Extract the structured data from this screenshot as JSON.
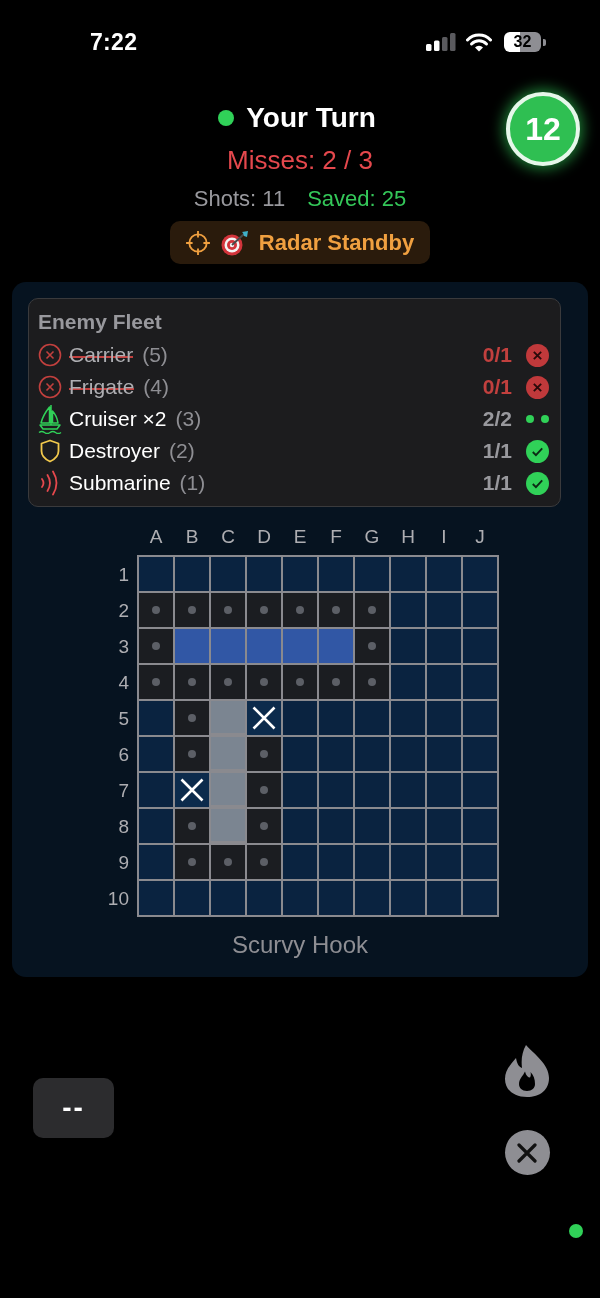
{
  "status_bar": {
    "time": "7:22",
    "battery": "32"
  },
  "turn": {
    "label": "Your Turn",
    "active": true,
    "timer": "12"
  },
  "misses": "Misses: 2 / 3",
  "stats": {
    "shots": "Shots: 11",
    "saved": "Saved: 25"
  },
  "radar": {
    "label": "Radar Standby"
  },
  "fleet": {
    "title": "Enemy Fleet",
    "ships": [
      {
        "kind": "sunk",
        "name": "Carrier",
        "size": "(5)",
        "count": "0/1"
      },
      {
        "kind": "sunk",
        "name": "Frigate",
        "size": "(4)",
        "count": "0/1"
      },
      {
        "kind": "cruiser",
        "name": "Cruiser ×2",
        "size": "(3)",
        "count": "2/2"
      },
      {
        "kind": "destroyer",
        "name": "Destroyer",
        "size": "(2)",
        "count": "1/1"
      },
      {
        "kind": "submarine",
        "name": "Submarine",
        "size": "(1)",
        "count": "1/1"
      }
    ]
  },
  "board": {
    "columns": [
      "A",
      "B",
      "C",
      "D",
      "E",
      "F",
      "G",
      "H",
      "I",
      "J"
    ],
    "rows": [
      {
        "label": "1",
        "cells": [
          {
            "kind": "fog"
          },
          {
            "kind": "fog"
          },
          {
            "kind": "fog"
          },
          {
            "kind": "fog"
          },
          {
            "kind": "fog"
          },
          {
            "kind": "fog"
          },
          {
            "kind": "fog"
          },
          {
            "kind": "fog"
          },
          {
            "kind": "fog"
          },
          {
            "kind": "fog"
          }
        ]
      },
      {
        "label": "2",
        "cells": [
          {
            "kind": "miss"
          },
          {
            "kind": "miss"
          },
          {
            "kind": "miss"
          },
          {
            "kind": "miss"
          },
          {
            "kind": "miss"
          },
          {
            "kind": "miss"
          },
          {
            "kind": "miss"
          },
          {
            "kind": "fog"
          },
          {
            "kind": "fog"
          },
          {
            "kind": "fog"
          }
        ]
      },
      {
        "label": "3",
        "cells": [
          {
            "kind": "miss"
          },
          {
            "kind": "sunk"
          },
          {
            "kind": "sunk"
          },
          {
            "kind": "sunk"
          },
          {
            "kind": "sunk"
          },
          {
            "kind": "sunk"
          },
          {
            "kind": "miss"
          },
          {
            "kind": "fog"
          },
          {
            "kind": "fog"
          },
          {
            "kind": "fog"
          }
        ]
      },
      {
        "label": "4",
        "cells": [
          {
            "kind": "miss"
          },
          {
            "kind": "miss"
          },
          {
            "kind": "miss"
          },
          {
            "kind": "miss"
          },
          {
            "kind": "miss"
          },
          {
            "kind": "miss"
          },
          {
            "kind": "miss"
          },
          {
            "kind": "fog"
          },
          {
            "kind": "fog"
          },
          {
            "kind": "fog"
          }
        ]
      },
      {
        "label": "5",
        "cells": [
          {
            "kind": "fog"
          },
          {
            "kind": "miss"
          },
          {
            "kind": "ship"
          },
          {
            "kind": "hit"
          },
          {
            "kind": "fog"
          },
          {
            "kind": "fog"
          },
          {
            "kind": "fog"
          },
          {
            "kind": "fog"
          },
          {
            "kind": "fog"
          },
          {
            "kind": "fog"
          }
        ]
      },
      {
        "label": "6",
        "cells": [
          {
            "kind": "fog"
          },
          {
            "kind": "miss"
          },
          {
            "kind": "ship"
          },
          {
            "kind": "miss"
          },
          {
            "kind": "fog"
          },
          {
            "kind": "fog"
          },
          {
            "kind": "fog"
          },
          {
            "kind": "fog"
          },
          {
            "kind": "fog"
          },
          {
            "kind": "fog"
          }
        ]
      },
      {
        "label": "7",
        "cells": [
          {
            "kind": "fog"
          },
          {
            "kind": "hit"
          },
          {
            "kind": "ship"
          },
          {
            "kind": "miss"
          },
          {
            "kind": "fog"
          },
          {
            "kind": "fog"
          },
          {
            "kind": "fog"
          },
          {
            "kind": "fog"
          },
          {
            "kind": "fog"
          },
          {
            "kind": "fog"
          }
        ]
      },
      {
        "label": "8",
        "cells": [
          {
            "kind": "fog"
          },
          {
            "kind": "miss"
          },
          {
            "kind": "ship"
          },
          {
            "kind": "miss"
          },
          {
            "kind": "fog"
          },
          {
            "kind": "fog"
          },
          {
            "kind": "fog"
          },
          {
            "kind": "fog"
          },
          {
            "kind": "fog"
          },
          {
            "kind": "fog"
          }
        ]
      },
      {
        "label": "9",
        "cells": [
          {
            "kind": "fog"
          },
          {
            "kind": "miss"
          },
          {
            "kind": "miss"
          },
          {
            "kind": "miss"
          },
          {
            "kind": "fog"
          },
          {
            "kind": "fog"
          },
          {
            "kind": "fog"
          },
          {
            "kind": "fog"
          },
          {
            "kind": "fog"
          },
          {
            "kind": "fog"
          }
        ]
      },
      {
        "label": "10",
        "cells": [
          {
            "kind": "fog"
          },
          {
            "kind": "fog"
          },
          {
            "kind": "fog"
          },
          {
            "kind": "fog"
          },
          {
            "kind": "fog"
          },
          {
            "kind": "fog"
          },
          {
            "kind": "fog"
          },
          {
            "kind": "fog"
          },
          {
            "kind": "fog"
          },
          {
            "kind": "fog"
          }
        ]
      }
    ],
    "caption": "Scurvy Hook"
  },
  "controls": {
    "action": "--"
  },
  "connection": {
    "online": true
  }
}
